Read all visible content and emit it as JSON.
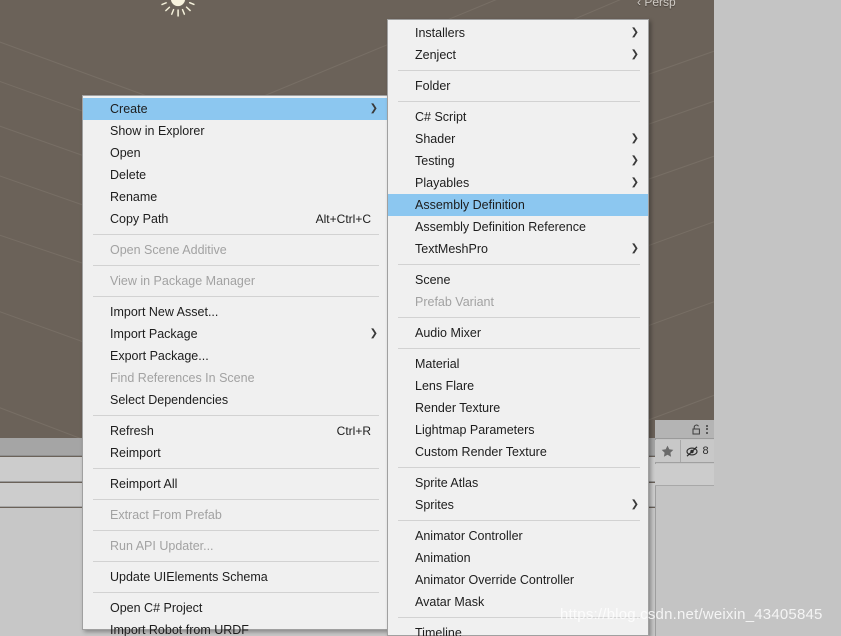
{
  "scene": {
    "view_label": "Persp",
    "light_gizmo_name": "directional-light-gizmo",
    "inspector": {
      "lock_icon": "lock-icon",
      "menu_icon": "kebab-menu-icon",
      "favorite_icon": "star-icon",
      "hidden_icon": "eye-off-icon",
      "hidden_count": "8"
    }
  },
  "watermark": "https://blog.csdn.net/weixin_43405845",
  "colors": {
    "highlight": "#8cc7f0",
    "menu_bg": "#f0f0f0",
    "scene_bg": "#6b6259",
    "editor_bg": "#c4c4c4",
    "text": "#1d1d1d",
    "text_disabled": "#a2a2a2"
  },
  "assets_context_menu": {
    "name": "assets-context-menu",
    "items": [
      {
        "label": "Create",
        "shortcut": "",
        "submenu": true,
        "disabled": false,
        "selected": true,
        "sep_after": false
      },
      {
        "label": "Show in Explorer",
        "shortcut": "",
        "submenu": false,
        "disabled": false,
        "selected": false,
        "sep_after": false
      },
      {
        "label": "Open",
        "shortcut": "",
        "submenu": false,
        "disabled": false,
        "selected": false,
        "sep_after": false
      },
      {
        "label": "Delete",
        "shortcut": "",
        "submenu": false,
        "disabled": false,
        "selected": false,
        "sep_after": false
      },
      {
        "label": "Rename",
        "shortcut": "",
        "submenu": false,
        "disabled": false,
        "selected": false,
        "sep_after": false
      },
      {
        "label": "Copy Path",
        "shortcut": "Alt+Ctrl+C",
        "submenu": false,
        "disabled": false,
        "selected": false,
        "sep_after": true
      },
      {
        "label": "Open Scene Additive",
        "shortcut": "",
        "submenu": false,
        "disabled": true,
        "selected": false,
        "sep_after": true
      },
      {
        "label": "View in Package Manager",
        "shortcut": "",
        "submenu": false,
        "disabled": true,
        "selected": false,
        "sep_after": true
      },
      {
        "label": "Import New Asset...",
        "shortcut": "",
        "submenu": false,
        "disabled": false,
        "selected": false,
        "sep_after": false
      },
      {
        "label": "Import Package",
        "shortcut": "",
        "submenu": true,
        "disabled": false,
        "selected": false,
        "sep_after": false
      },
      {
        "label": "Export Package...",
        "shortcut": "",
        "submenu": false,
        "disabled": false,
        "selected": false,
        "sep_after": false
      },
      {
        "label": "Find References In Scene",
        "shortcut": "",
        "submenu": false,
        "disabled": true,
        "selected": false,
        "sep_after": false
      },
      {
        "label": "Select Dependencies",
        "shortcut": "",
        "submenu": false,
        "disabled": false,
        "selected": false,
        "sep_after": true
      },
      {
        "label": "Refresh",
        "shortcut": "Ctrl+R",
        "submenu": false,
        "disabled": false,
        "selected": false,
        "sep_after": false
      },
      {
        "label": "Reimport",
        "shortcut": "",
        "submenu": false,
        "disabled": false,
        "selected": false,
        "sep_after": true
      },
      {
        "label": "Reimport All",
        "shortcut": "",
        "submenu": false,
        "disabled": false,
        "selected": false,
        "sep_after": true
      },
      {
        "label": "Extract From Prefab",
        "shortcut": "",
        "submenu": false,
        "disabled": true,
        "selected": false,
        "sep_after": true
      },
      {
        "label": "Run API Updater...",
        "shortcut": "",
        "submenu": false,
        "disabled": true,
        "selected": false,
        "sep_after": true
      },
      {
        "label": "Update UIElements Schema",
        "shortcut": "",
        "submenu": false,
        "disabled": false,
        "selected": false,
        "sep_after": true
      },
      {
        "label": "Open C# Project",
        "shortcut": "",
        "submenu": false,
        "disabled": false,
        "selected": false,
        "sep_after": false
      },
      {
        "label": "Import Robot from URDF",
        "shortcut": "",
        "submenu": false,
        "disabled": false,
        "selected": false,
        "sep_after": false
      }
    ]
  },
  "create_submenu": {
    "name": "create-submenu",
    "items": [
      {
        "label": "Installers",
        "shortcut": "",
        "submenu": true,
        "disabled": false,
        "selected": false,
        "sep_after": false
      },
      {
        "label": "Zenject",
        "shortcut": "",
        "submenu": true,
        "disabled": false,
        "selected": false,
        "sep_after": true
      },
      {
        "label": "Folder",
        "shortcut": "",
        "submenu": false,
        "disabled": false,
        "selected": false,
        "sep_after": true
      },
      {
        "label": "C# Script",
        "shortcut": "",
        "submenu": false,
        "disabled": false,
        "selected": false,
        "sep_after": false
      },
      {
        "label": "Shader",
        "shortcut": "",
        "submenu": true,
        "disabled": false,
        "selected": false,
        "sep_after": false
      },
      {
        "label": "Testing",
        "shortcut": "",
        "submenu": true,
        "disabled": false,
        "selected": false,
        "sep_after": false
      },
      {
        "label": "Playables",
        "shortcut": "",
        "submenu": true,
        "disabled": false,
        "selected": false,
        "sep_after": false
      },
      {
        "label": "Assembly Definition",
        "shortcut": "",
        "submenu": false,
        "disabled": false,
        "selected": true,
        "sep_after": false
      },
      {
        "label": "Assembly Definition Reference",
        "shortcut": "",
        "submenu": false,
        "disabled": false,
        "selected": false,
        "sep_after": false
      },
      {
        "label": "TextMeshPro",
        "shortcut": "",
        "submenu": true,
        "disabled": false,
        "selected": false,
        "sep_after": true
      },
      {
        "label": "Scene",
        "shortcut": "",
        "submenu": false,
        "disabled": false,
        "selected": false,
        "sep_after": false
      },
      {
        "label": "Prefab Variant",
        "shortcut": "",
        "submenu": false,
        "disabled": true,
        "selected": false,
        "sep_after": true
      },
      {
        "label": "Audio Mixer",
        "shortcut": "",
        "submenu": false,
        "disabled": false,
        "selected": false,
        "sep_after": true
      },
      {
        "label": "Material",
        "shortcut": "",
        "submenu": false,
        "disabled": false,
        "selected": false,
        "sep_after": false
      },
      {
        "label": "Lens Flare",
        "shortcut": "",
        "submenu": false,
        "disabled": false,
        "selected": false,
        "sep_after": false
      },
      {
        "label": "Render Texture",
        "shortcut": "",
        "submenu": false,
        "disabled": false,
        "selected": false,
        "sep_after": false
      },
      {
        "label": "Lightmap Parameters",
        "shortcut": "",
        "submenu": false,
        "disabled": false,
        "selected": false,
        "sep_after": false
      },
      {
        "label": "Custom Render Texture",
        "shortcut": "",
        "submenu": false,
        "disabled": false,
        "selected": false,
        "sep_after": true
      },
      {
        "label": "Sprite Atlas",
        "shortcut": "",
        "submenu": false,
        "disabled": false,
        "selected": false,
        "sep_after": false
      },
      {
        "label": "Sprites",
        "shortcut": "",
        "submenu": true,
        "disabled": false,
        "selected": false,
        "sep_after": true
      },
      {
        "label": "Animator Controller",
        "shortcut": "",
        "submenu": false,
        "disabled": false,
        "selected": false,
        "sep_after": false
      },
      {
        "label": "Animation",
        "shortcut": "",
        "submenu": false,
        "disabled": false,
        "selected": false,
        "sep_after": false
      },
      {
        "label": "Animator Override Controller",
        "shortcut": "",
        "submenu": false,
        "disabled": false,
        "selected": false,
        "sep_after": false
      },
      {
        "label": "Avatar Mask",
        "shortcut": "",
        "submenu": false,
        "disabled": false,
        "selected": false,
        "sep_after": true
      },
      {
        "label": "Timeline",
        "shortcut": "",
        "submenu": false,
        "disabled": false,
        "selected": false,
        "sep_after": false
      }
    ]
  }
}
